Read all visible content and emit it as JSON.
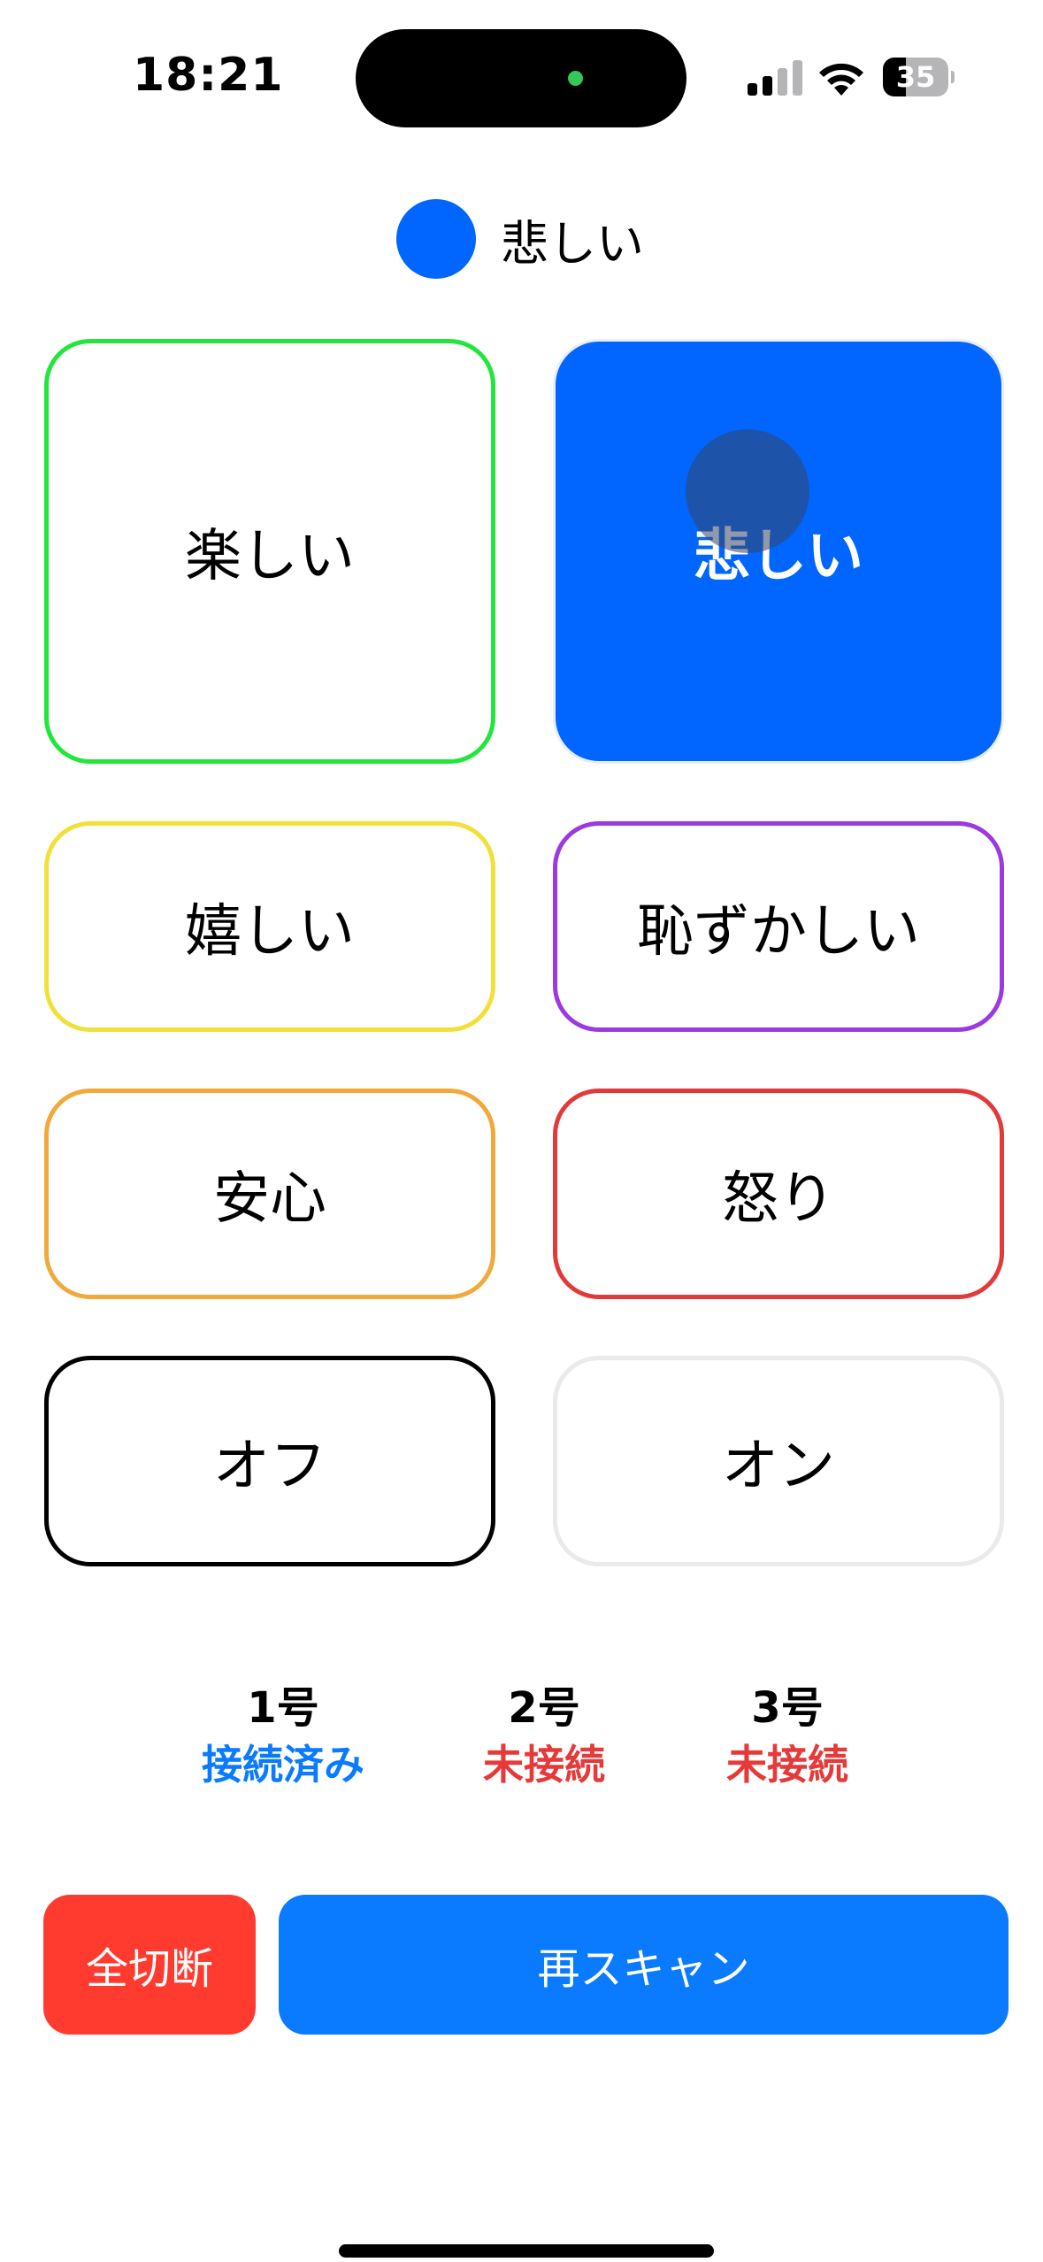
{
  "status_bar": {
    "time": "18:21",
    "battery": "35",
    "battery_level": 0.35
  },
  "current_mood": {
    "label": "悲しい",
    "color": "#0066ff"
  },
  "moods": [
    {
      "label": "楽しい",
      "color": "#22e63c",
      "selected": false
    },
    {
      "label": "悲しい",
      "color": "#0066ff",
      "selected": true
    },
    {
      "label": "嬉しい",
      "color": "#f2e03a",
      "selected": false
    },
    {
      "label": "恥ずかしい",
      "color": "#9b3ae0",
      "selected": false
    },
    {
      "label": "安心",
      "color": "#f2a93c",
      "selected": false
    },
    {
      "label": "怒り",
      "color": "#e23a3a",
      "selected": false
    },
    {
      "label": "オフ",
      "color": "#000000",
      "selected": false
    },
    {
      "label": "オン",
      "color": "#eaeaea",
      "selected": false
    }
  ],
  "devices": [
    {
      "name": "1号",
      "status": "接続済み",
      "status_color": "#0a7aff"
    },
    {
      "name": "2号",
      "status": "未接続",
      "status_color": "#e63a3a"
    },
    {
      "name": "3号",
      "status": "未接続",
      "status_color": "#e63a3a"
    }
  ],
  "actions": {
    "disconnect_all": "全切断",
    "disconnect_color": "#ff3b30",
    "rescan": "再スキャン",
    "rescan_color": "#0a7aff"
  }
}
